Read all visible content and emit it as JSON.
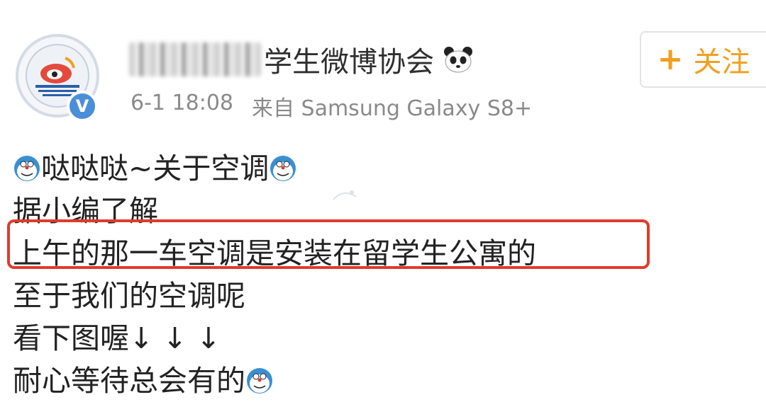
{
  "account": {
    "name_suffix": "学生微博协会",
    "verified_mark": "V",
    "time": "6-1 18:08",
    "source": "来自 Samsung Galaxy S8+"
  },
  "follow_button": {
    "plus": "+",
    "label": "关注"
  },
  "post": {
    "lines": [
      "哒哒哒~关于空调",
      "据小编了解",
      "上午的那一车空调是安装在留学生公寓的",
      "至于我们的空调呢",
      "看下图喔↓ ↓ ↓",
      "耐心等待总会有的"
    ]
  },
  "colors": {
    "highlight": "#e03b2c",
    "follow": "#f0a020",
    "verified": "#4a8fd8"
  },
  "icons": [
    "sina-weibo-logo-icon",
    "verified-badge-icon",
    "panda-emoji-icon",
    "plus-icon",
    "doraemon-emoji-icon"
  ]
}
